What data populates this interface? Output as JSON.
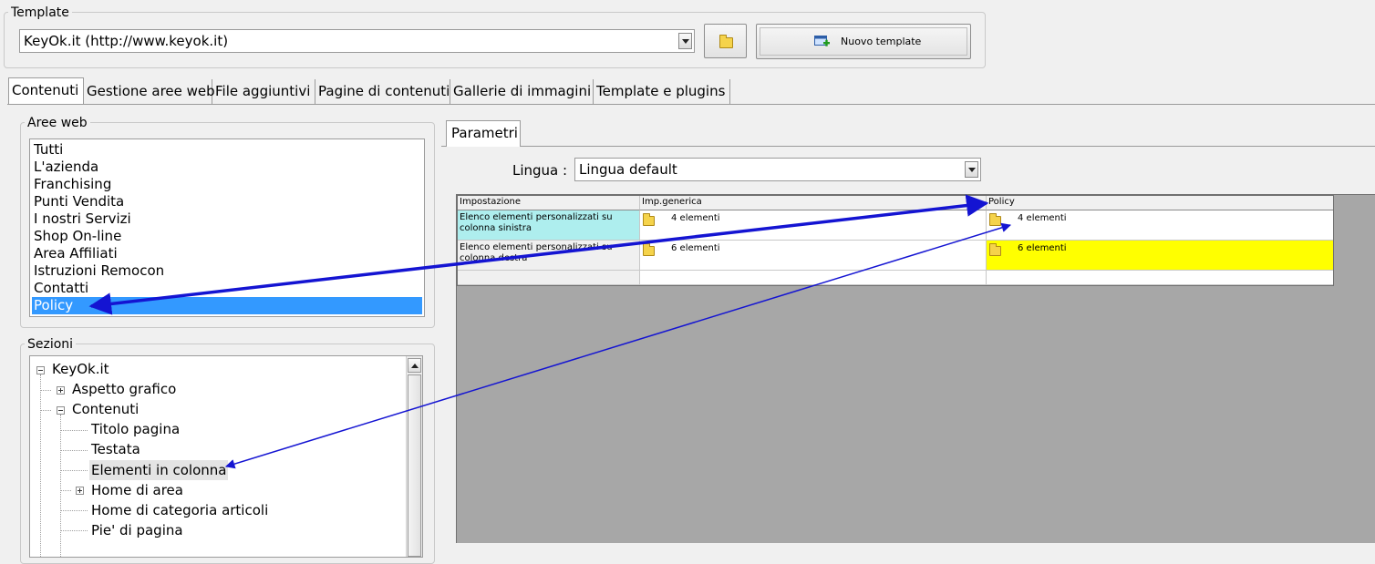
{
  "template": {
    "legend": "Template",
    "selected": "KeyOk.it (http://www.keyok.it)",
    "new_template_label": "Nuovo template"
  },
  "tabs": [
    "Contenuti",
    "Gestione aree web",
    "File aggiuntivi",
    "Pagine di contenuti",
    "Gallerie di immagini",
    "Template e plugins"
  ],
  "aree_web": {
    "legend": "Aree web",
    "items": [
      "Tutti",
      "L'azienda",
      "Franchising",
      "Punti Vendita",
      "I nostri Servizi",
      "Shop On-line",
      "Area Affiliati",
      "Istruzioni Remocon",
      "Contatti",
      "Policy"
    ],
    "selected_index": 9
  },
  "sezioni": {
    "legend": "Sezioni",
    "tree": [
      {
        "label": "KeyOk.it",
        "expander": "minus"
      },
      {
        "label": "Aspetto grafico",
        "expander": "plus"
      },
      {
        "label": "Contenuti",
        "expander": "minus"
      },
      {
        "label": "Titolo pagina"
      },
      {
        "label": "Testata"
      },
      {
        "label": "Elementi in colonna",
        "highlight": true
      },
      {
        "label": "Home di area",
        "expander": "plus"
      },
      {
        "label": "Home di categoria articoli"
      },
      {
        "label": "Pie' di pagina"
      }
    ]
  },
  "parametri": {
    "tab_label": "Parametri",
    "lingua_label": "Lingua :",
    "lingua_value": "Lingua default",
    "grid": {
      "columns": [
        "Impostazione",
        "Imp.generica",
        "Policy"
      ],
      "rows": [
        {
          "setting": "Elenco elementi personalizzati su colonna sinistra",
          "generic": "4 elementi",
          "policy": "4 elementi"
        },
        {
          "setting": "Elenco elementi personalizzati su colonna destra",
          "generic": "6 elementi",
          "policy": "6 elementi"
        }
      ]
    }
  },
  "colors": {
    "selection": "#3399ff",
    "setting_highlight": "#aeeeee",
    "cell_highlight": "#ffff00",
    "annotation_arrow": "#1414d2"
  }
}
